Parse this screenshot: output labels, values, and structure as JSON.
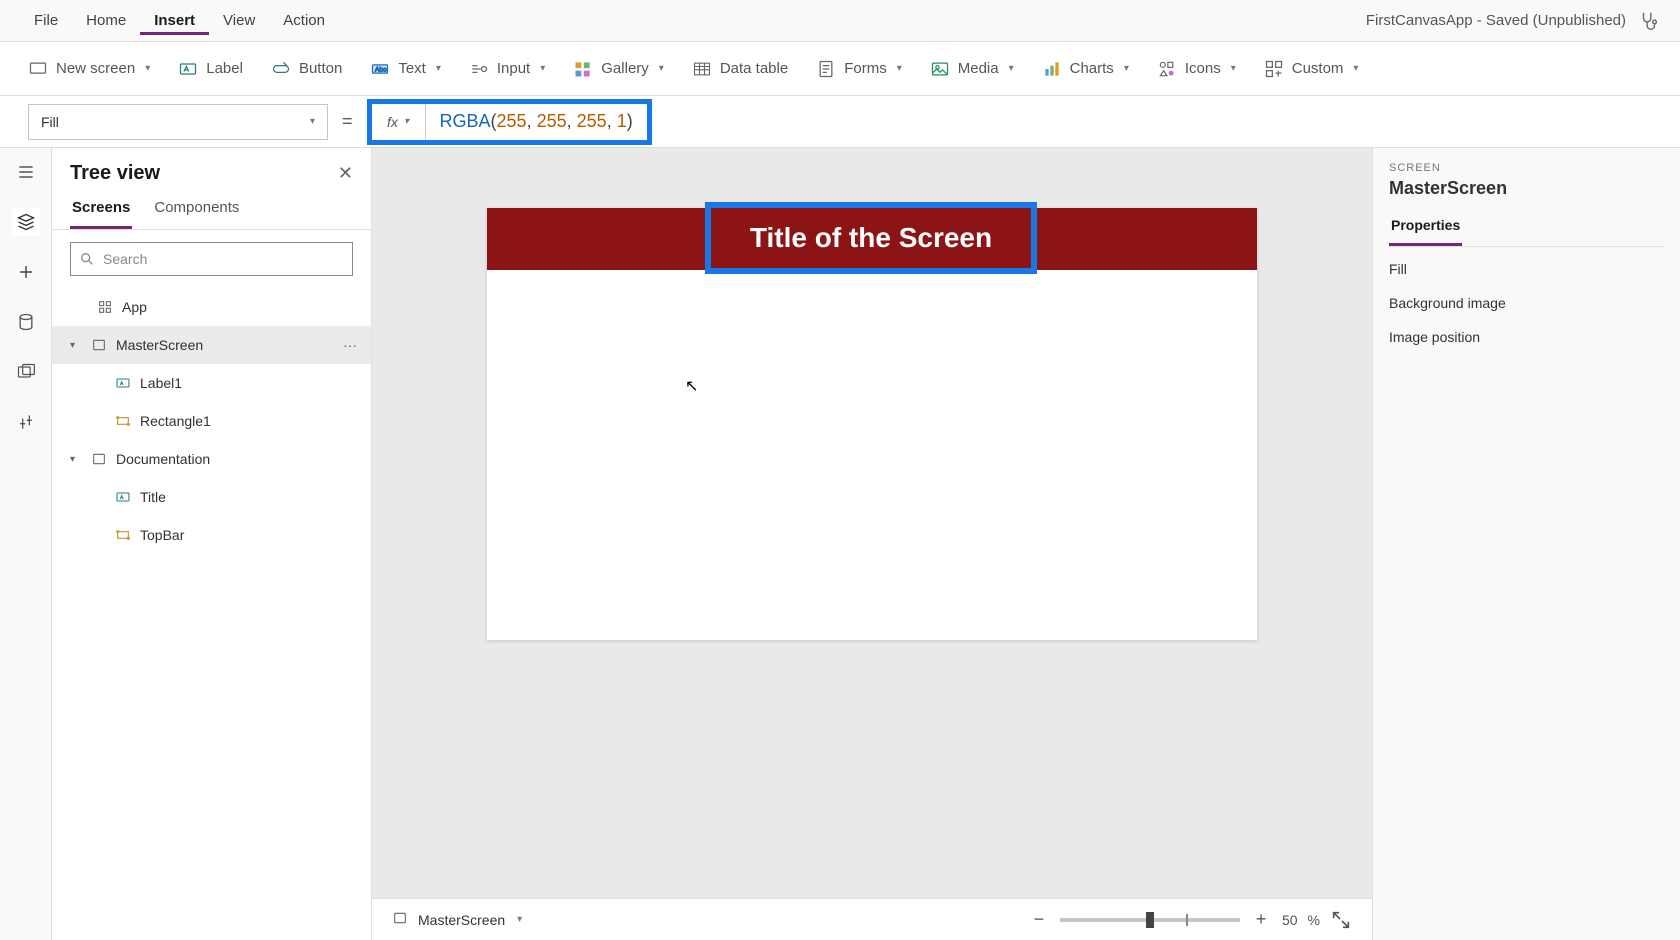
{
  "menubar": {
    "items": [
      "File",
      "Home",
      "Insert",
      "View",
      "Action"
    ],
    "active_index": 2,
    "app_title": "FirstCanvasApp - Saved (Unpublished)"
  },
  "ribbon": {
    "new_screen": "New screen",
    "label": "Label",
    "button": "Button",
    "text": "Text",
    "input": "Input",
    "gallery": "Gallery",
    "data_table": "Data table",
    "forms": "Forms",
    "media": "Media",
    "charts": "Charts",
    "icons": "Icons",
    "custom": "Custom"
  },
  "formula": {
    "property": "Fill",
    "fx_label": "fx",
    "func": "RGBA",
    "paren_open": "(",
    "args": [
      "255",
      "255",
      "255",
      "1"
    ],
    "comma": ", ",
    "paren_close": ")"
  },
  "tree": {
    "title": "Tree view",
    "tabs": [
      "Screens",
      "Components"
    ],
    "active_tab": 0,
    "search_placeholder": "Search",
    "app_label": "App",
    "nodes": [
      {
        "name": "MasterScreen",
        "selected": true,
        "children": [
          "Label1",
          "Rectangle1"
        ]
      },
      {
        "name": "Documentation",
        "selected": false,
        "children": [
          "Title",
          "TopBar"
        ]
      }
    ],
    "more_dots": "···"
  },
  "canvas": {
    "title_text": "Title of the Screen",
    "topbar_color": "#8d1414"
  },
  "canvas_footer": {
    "screen_label": "MasterScreen",
    "zoom_minus": "−",
    "zoom_plus": "+",
    "zoom_value": "50",
    "zoom_unit": "%"
  },
  "rightpane": {
    "kind": "SCREEN",
    "objname": "MasterScreen",
    "tabs": [
      "Properties"
    ],
    "active_tab": 0,
    "props": [
      "Fill",
      "Background image",
      "Image position"
    ]
  }
}
